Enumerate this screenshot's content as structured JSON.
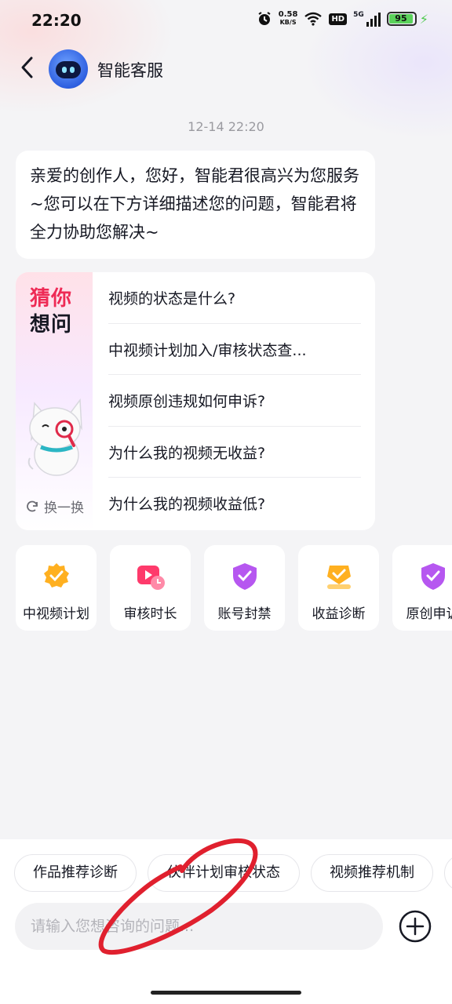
{
  "status": {
    "time": "22:20",
    "net_speed": "0.58",
    "net_unit": "KB/S",
    "hd": "HD",
    "signal": "5G",
    "battery": "95"
  },
  "header": {
    "title": "智能客服"
  },
  "chat": {
    "timestamp": "12-14 22:20",
    "greeting": "亲爱的创作人，您好，智能君很高兴为您服务~您可以在下方详细描述您的问题，智能君将全力协助您解决~"
  },
  "guess": {
    "title_line1": "猜你",
    "title_line2": "想问",
    "refresh_label": "换一换",
    "questions": [
      "视频的状态是什么?",
      "中视频计划加入/审核状态查...",
      "视频原创违规如何申诉?",
      "为什么我的视频无收益?",
      "为什么我的视频收益低?"
    ]
  },
  "categories": [
    {
      "label": "中视频计划",
      "icon": "medal-icon",
      "color": "#ffb020"
    },
    {
      "label": "审核时长",
      "icon": "video-clock-icon",
      "color": "#fe3a6b"
    },
    {
      "label": "账号封禁",
      "icon": "shield-check-icon",
      "color": "#b657f0"
    },
    {
      "label": "收益诊断",
      "icon": "coin-check-icon",
      "color": "#ffb020"
    },
    {
      "label": "原创申诉",
      "icon": "shield-check-icon",
      "color": "#b657f0"
    }
  ],
  "quick_chips": [
    "作品推荐诊断",
    "伙伴计划审核状态",
    "视频推荐机制"
  ],
  "input": {
    "placeholder": "请输入您想咨询的问题..."
  },
  "colors": {
    "accent": "#ee2a55",
    "background": "#f4f4f6",
    "annotation": "#e0202e"
  }
}
